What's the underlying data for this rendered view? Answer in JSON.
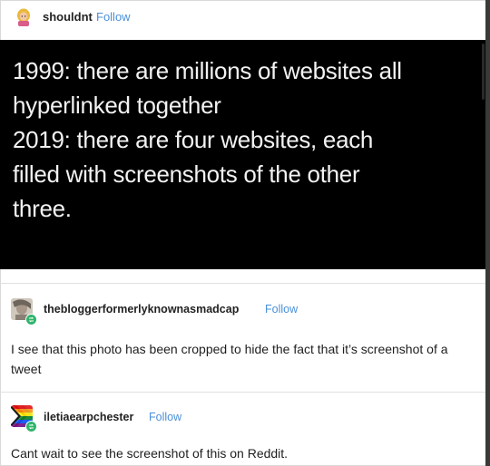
{
  "colors": {
    "follow": "#4a90d9",
    "panel": "#000000",
    "badge": "#2fb46b"
  },
  "post": {
    "username": "shouldnt",
    "follow_label": "Follow",
    "avatar_icon": "blonde-person-icon",
    "tweet_lines": [
      "1999: there are millions of websites all",
      "hyperlinked together",
      "2019: there are four websites, each",
      "filled with screenshots of the other",
      "three."
    ]
  },
  "reblogs": [
    {
      "username": "thebloggerformerlyknownasmadcap",
      "follow_label": "Follow",
      "avatar_icon": "portrait-avatar-icon",
      "text": "I see that this photo has been cropped to hide the fact that it’s screenshot of a tweet"
    },
    {
      "username": "iletiaearpchester",
      "follow_label": "Follow",
      "avatar_icon": "pride-flag-avatar-icon",
      "text": "Cant wait to see the screenshot of this on Reddit."
    }
  ]
}
